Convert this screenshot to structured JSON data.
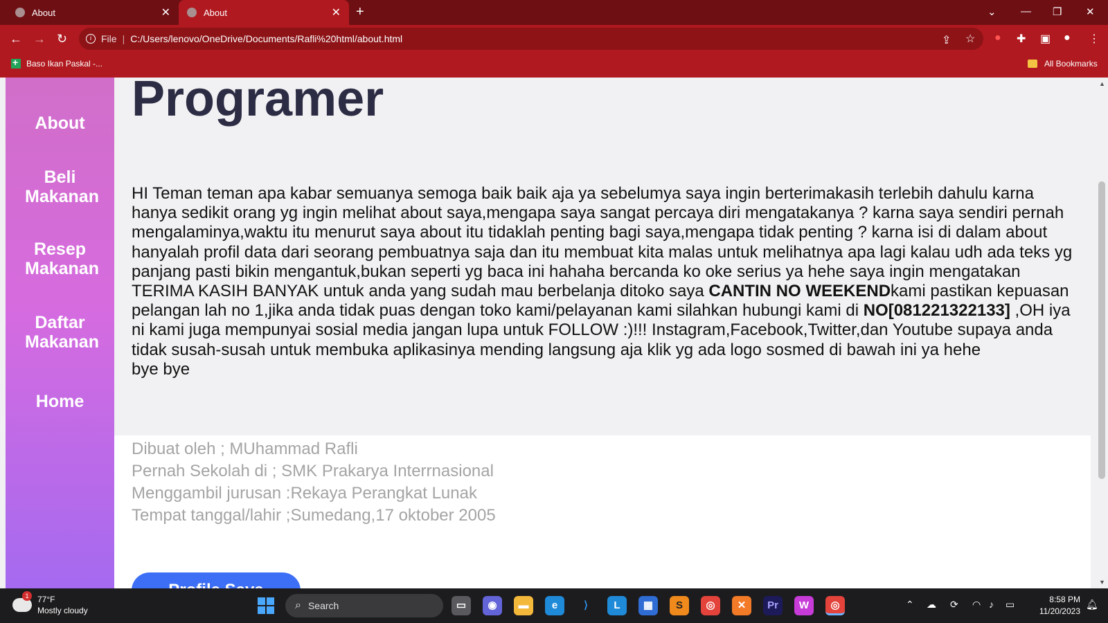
{
  "browser": {
    "tabs": [
      {
        "title": "About",
        "active": false
      },
      {
        "title": "About",
        "active": true
      }
    ],
    "address": {
      "scheme_label": "File",
      "url": "C:/Users/lenovo/OneDrive/Documents/Rafli%20html/about.html"
    },
    "bookmarks": {
      "left": "Baso Ikan Paskal -...",
      "right": "All Bookmarks"
    }
  },
  "sidebar": {
    "items": [
      {
        "label": "About"
      },
      {
        "label": "Beli Makanan"
      },
      {
        "label": "Resep Makanan"
      },
      {
        "label": "Daftar Makanan"
      },
      {
        "label": "Home"
      }
    ]
  },
  "main": {
    "heading": "Programer",
    "paragraph": {
      "p1": "HI Teman teman apa kabar semuanya semoga baik baik aja ya sebelumya saya ingin berterimakasih terlebih dahulu karna hanya sedikit orang yg ingin melihat about saya,mengapa saya sangat percaya diri mengatakanya ? karna saya sendiri pernah mengalaminya,waktu itu menurut saya about itu tidaklah penting bagi saya,mengapa tidak penting ? karna isi di dalam about hanyalah profil data dari seorang pembuatnya saja dan itu membuat kita malas untuk melihatnya apa lagi kalau udh ada teks yg panjang pasti bikin mengantuk,bukan seperti yg baca ini hahaha bercanda ko oke serius ya hehe saya ingin mengatakan TERIMA KASIH BANYAK untuk anda yang sudah mau berbelanja ditoko saya ",
      "bold1": "CANTIN NO WEEKEND",
      "p2": "kami pastikan kepuasan pelangan lah no 1,jika anda tidak puas dengan toko kami/pelayanan kami silahkan hubungi kami di ",
      "bold2": "NO[081221322133]",
      "p3": " ,OH iya ni kami juga mempunyai sosial media jangan lupa untuk FOLLOW :)!!! Instagram,Facebook,Twitter,dan Youtube supaya anda tidak susah-susah untuk membuka aplikasinya mending langsung aja klik yg ada logo sosmed di bawah ini ya hehe",
      "closing": "bye bye"
    },
    "info": [
      "Dibuat oleh ; MUhammad Rafli",
      "Pernah Sekolah di ; SMK Prakarya Interrnasional",
      "Menggambil jurusan :Rekaya Perangkat Lunak",
      "Tempat tanggal/lahir ;Sumedang,17 oktober 2005"
    ],
    "profile_button": "Profile Saya"
  },
  "taskbar": {
    "weather": {
      "temp": "77°F",
      "condition": "Mostly cloudy",
      "badge": "1"
    },
    "search_placeholder": "Search",
    "time": "8:58 PM",
    "date": "11/20/2023"
  },
  "colors": {
    "chrome_dark": "#6e0f14",
    "chrome": "#b0191f",
    "sidebar_top": "#d16ec9",
    "sidebar_bottom": "#a56af0",
    "button": "#3d6ff6"
  }
}
